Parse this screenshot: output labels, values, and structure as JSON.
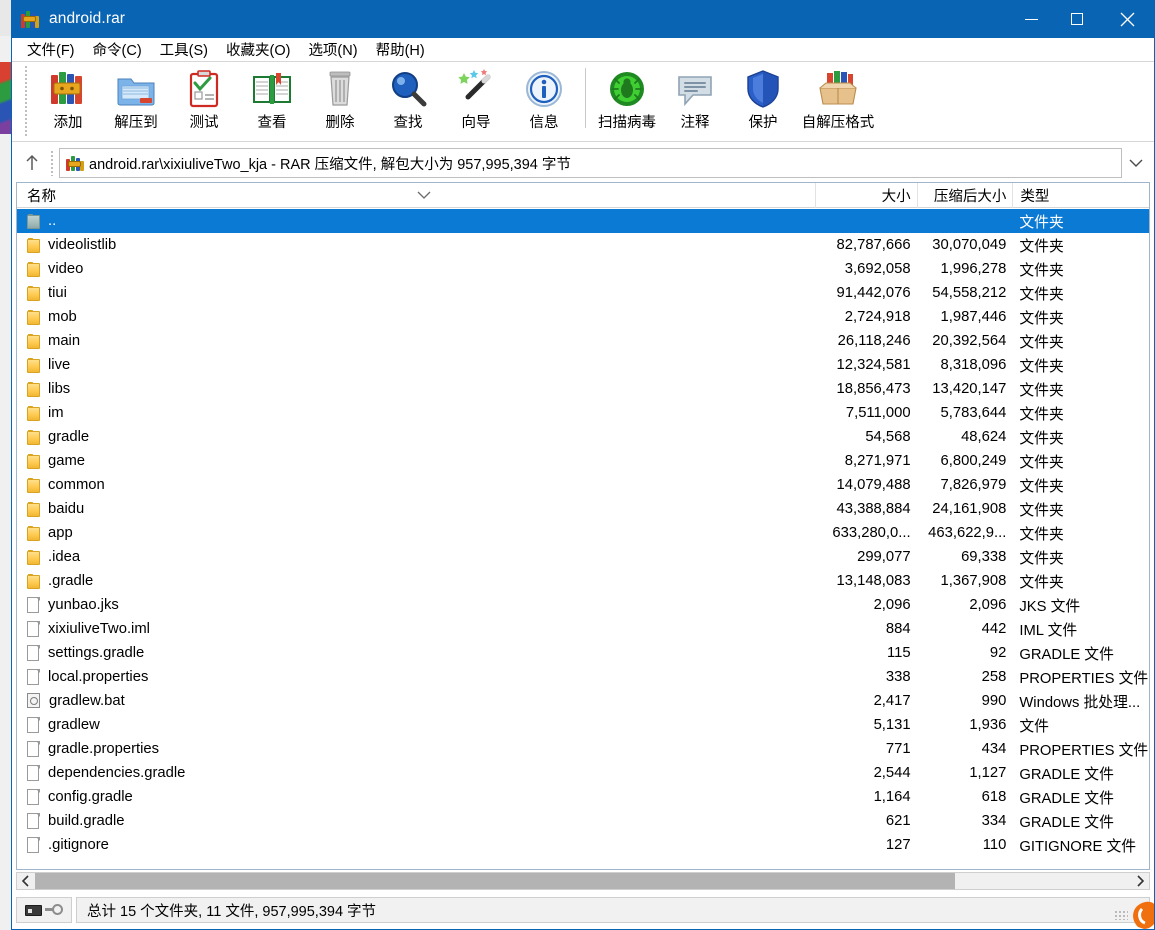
{
  "window": {
    "title": "android.rar",
    "icon": "winrar-icon",
    "controls": {
      "minimize": "—",
      "maximize": "□",
      "close": "✕"
    },
    "accent_color": "#0a64b4",
    "selection_color": "#0a7ad4"
  },
  "menu": [
    {
      "label": "文件(F)",
      "name": "menu-file"
    },
    {
      "label": "命令(C)",
      "name": "menu-commands"
    },
    {
      "label": "工具(S)",
      "name": "menu-tools"
    },
    {
      "label": "收藏夹(O)",
      "name": "menu-favorites"
    },
    {
      "label": "选项(N)",
      "name": "menu-options"
    },
    {
      "label": "帮助(H)",
      "name": "menu-help"
    }
  ],
  "toolbar": [
    {
      "label": "添加",
      "icon": "add-archive-icon",
      "name": "toolbar-add"
    },
    {
      "label": "解压到",
      "icon": "extract-to-icon",
      "name": "toolbar-extract-to"
    },
    {
      "label": "测试",
      "icon": "test-icon",
      "name": "toolbar-test"
    },
    {
      "label": "查看",
      "icon": "view-icon",
      "name": "toolbar-view"
    },
    {
      "label": "删除",
      "icon": "delete-icon",
      "name": "toolbar-delete"
    },
    {
      "label": "查找",
      "icon": "find-icon",
      "name": "toolbar-find"
    },
    {
      "label": "向导",
      "icon": "wizard-icon",
      "name": "toolbar-wizard"
    },
    {
      "label": "信息",
      "icon": "info-icon",
      "name": "toolbar-info"
    },
    {
      "label": "扫描病毒",
      "icon": "virus-scan-icon",
      "name": "toolbar-scan-virus"
    },
    {
      "label": "注释",
      "icon": "comment-icon",
      "name": "toolbar-comment"
    },
    {
      "label": "保护",
      "icon": "protect-icon",
      "name": "toolbar-protect"
    },
    {
      "label": "自解压格式",
      "icon": "sfx-icon",
      "name": "toolbar-sfx"
    }
  ],
  "address": {
    "up_icon": "up-arrow-icon",
    "archive_icon": "winrar-icon",
    "path_text": "android.rar\\xixiuliveTwo_kja - RAR 压缩文件, 解包大小为 957,995,394 字节",
    "dropdown_icon": "chevron-down-icon"
  },
  "columns": [
    {
      "label": "名称",
      "name": "column-name"
    },
    {
      "label": "大小",
      "name": "column-size"
    },
    {
      "label": "压缩后大小",
      "name": "column-packed-size"
    },
    {
      "label": "类型",
      "name": "column-type"
    }
  ],
  "sort_indicator": "chevron-down-icon",
  "rows": [
    {
      "name": "..",
      "size": "",
      "packed": "",
      "type": "文件夹",
      "icon": "up-folder-icon",
      "selected": true
    },
    {
      "name": "videolistlib",
      "size": "82,787,666",
      "packed": "30,070,049",
      "type": "文件夹",
      "icon": "folder-icon",
      "selected": false
    },
    {
      "name": "video",
      "size": "3,692,058",
      "packed": "1,996,278",
      "type": "文件夹",
      "icon": "folder-icon",
      "selected": false
    },
    {
      "name": "tiui",
      "size": "91,442,076",
      "packed": "54,558,212",
      "type": "文件夹",
      "icon": "folder-icon",
      "selected": false
    },
    {
      "name": "mob",
      "size": "2,724,918",
      "packed": "1,987,446",
      "type": "文件夹",
      "icon": "folder-icon",
      "selected": false
    },
    {
      "name": "main",
      "size": "26,118,246",
      "packed": "20,392,564",
      "type": "文件夹",
      "icon": "folder-icon",
      "selected": false
    },
    {
      "name": "live",
      "size": "12,324,581",
      "packed": "8,318,096",
      "type": "文件夹",
      "icon": "folder-icon",
      "selected": false
    },
    {
      "name": "libs",
      "size": "18,856,473",
      "packed": "13,420,147",
      "type": "文件夹",
      "icon": "folder-icon",
      "selected": false
    },
    {
      "name": "im",
      "size": "7,511,000",
      "packed": "5,783,644",
      "type": "文件夹",
      "icon": "folder-icon",
      "selected": false
    },
    {
      "name": "gradle",
      "size": "54,568",
      "packed": "48,624",
      "type": "文件夹",
      "icon": "folder-icon",
      "selected": false
    },
    {
      "name": "game",
      "size": "8,271,971",
      "packed": "6,800,249",
      "type": "文件夹",
      "icon": "folder-icon",
      "selected": false
    },
    {
      "name": "common",
      "size": "14,079,488",
      "packed": "7,826,979",
      "type": "文件夹",
      "icon": "folder-icon",
      "selected": false
    },
    {
      "name": "baidu",
      "size": "43,388,884",
      "packed": "24,161,908",
      "type": "文件夹",
      "icon": "folder-icon",
      "selected": false
    },
    {
      "name": "app",
      "size": "633,280,0...",
      "packed": "463,622,9...",
      "type": "文件夹",
      "icon": "folder-icon",
      "selected": false
    },
    {
      "name": ".idea",
      "size": "299,077",
      "packed": "69,338",
      "type": "文件夹",
      "icon": "folder-icon",
      "selected": false
    },
    {
      "name": ".gradle",
      "size": "13,148,083",
      "packed": "1,367,908",
      "type": "文件夹",
      "icon": "folder-icon",
      "selected": false
    },
    {
      "name": "yunbao.jks",
      "size": "2,096",
      "packed": "2,096",
      "type": "JKS 文件",
      "icon": "file-icon",
      "selected": false
    },
    {
      "name": "xixiuliveTwo.iml",
      "size": "884",
      "packed": "442",
      "type": "IML 文件",
      "icon": "file-icon",
      "selected": false
    },
    {
      "name": "settings.gradle",
      "size": "115",
      "packed": "92",
      "type": "GRADLE 文件",
      "icon": "file-icon",
      "selected": false
    },
    {
      "name": "local.properties",
      "size": "338",
      "packed": "258",
      "type": "PROPERTIES 文件",
      "icon": "file-icon",
      "selected": false
    },
    {
      "name": "gradlew.bat",
      "size": "2,417",
      "packed": "990",
      "type": "Windows 批处理...",
      "icon": "bat-file-icon",
      "selected": false
    },
    {
      "name": "gradlew",
      "size": "5,131",
      "packed": "1,936",
      "type": "文件",
      "icon": "file-icon",
      "selected": false
    },
    {
      "name": "gradle.properties",
      "size": "771",
      "packed": "434",
      "type": "PROPERTIES 文件",
      "icon": "file-icon",
      "selected": false
    },
    {
      "name": "dependencies.gradle",
      "size": "2,544",
      "packed": "1,127",
      "type": "GRADLE 文件",
      "icon": "file-icon",
      "selected": false
    },
    {
      "name": "config.gradle",
      "size": "1,164",
      "packed": "618",
      "type": "GRADLE 文件",
      "icon": "file-icon",
      "selected": false
    },
    {
      "name": "build.gradle",
      "size": "621",
      "packed": "334",
      "type": "GRADLE 文件",
      "icon": "file-icon",
      "selected": false
    },
    {
      "name": ".gitignore",
      "size": "127",
      "packed": "110",
      "type": "GITIGNORE 文件",
      "icon": "file-icon",
      "selected": false
    }
  ],
  "scrollbar": {
    "left_icon": "chevron-left-icon",
    "right_icon": "chevron-right-icon"
  },
  "statusbar": {
    "drive_icon": "drive-icon",
    "key_icon": "key-icon",
    "summary": "总计 15 个文件夹, 11 文件, 957,995,394 字节"
  }
}
